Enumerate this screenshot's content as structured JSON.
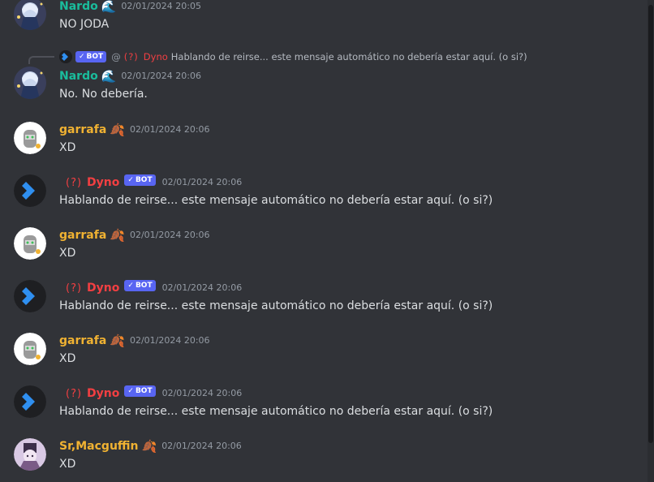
{
  "colors": {
    "background": "#313338",
    "nardo": "#1abc9c",
    "garrafa": "#f0b232",
    "dyno": "#f23f42",
    "bot_tag": "#5865f2",
    "timestamp": "#949ba4",
    "text": "#dbdee1"
  },
  "messages": [
    {
      "user": "Nardo",
      "emoji": "🌊",
      "time": "02/01/2024 20:05",
      "text": "NO JODA"
    },
    {
      "reply": {
        "bot": "BOT",
        "at": "@",
        "role": "(?)",
        "user": "Dyno",
        "text": "Hablando de reirse... este mensaje automático no debería estar aquí. (o si?)"
      },
      "user": "Nardo",
      "emoji": "🌊",
      "time": "02/01/2024 20:06",
      "text": "No. No debería."
    },
    {
      "user": "garrafa",
      "emoji": "🍂",
      "time": "02/01/2024 20:06",
      "text": "XD"
    },
    {
      "role": "(?)",
      "user": "Dyno",
      "bot": "BOT",
      "time": "02/01/2024 20:06",
      "text": "Hablando de reirse... este mensaje automático no debería estar aquí. (o si?)"
    },
    {
      "user": "garrafa",
      "emoji": "🍂",
      "time": "02/01/2024 20:06",
      "text": "XD"
    },
    {
      "role": "(?)",
      "user": "Dyno",
      "bot": "BOT",
      "time": "02/01/2024 20:06",
      "text": "Hablando de reirse... este mensaje automático no debería estar aquí. (o si?)"
    },
    {
      "user": "garrafa",
      "emoji": "🍂",
      "time": "02/01/2024 20:06",
      "text": "XD"
    },
    {
      "role": "(?)",
      "user": "Dyno",
      "bot": "BOT",
      "time": "02/01/2024 20:06",
      "text": "Hablando de reirse... este mensaje automático no debería estar aquí. (o si?)"
    },
    {
      "user": "Sr,Macguffin",
      "emoji": "🍂",
      "time": "02/01/2024 20:06",
      "text": "XD"
    }
  ]
}
